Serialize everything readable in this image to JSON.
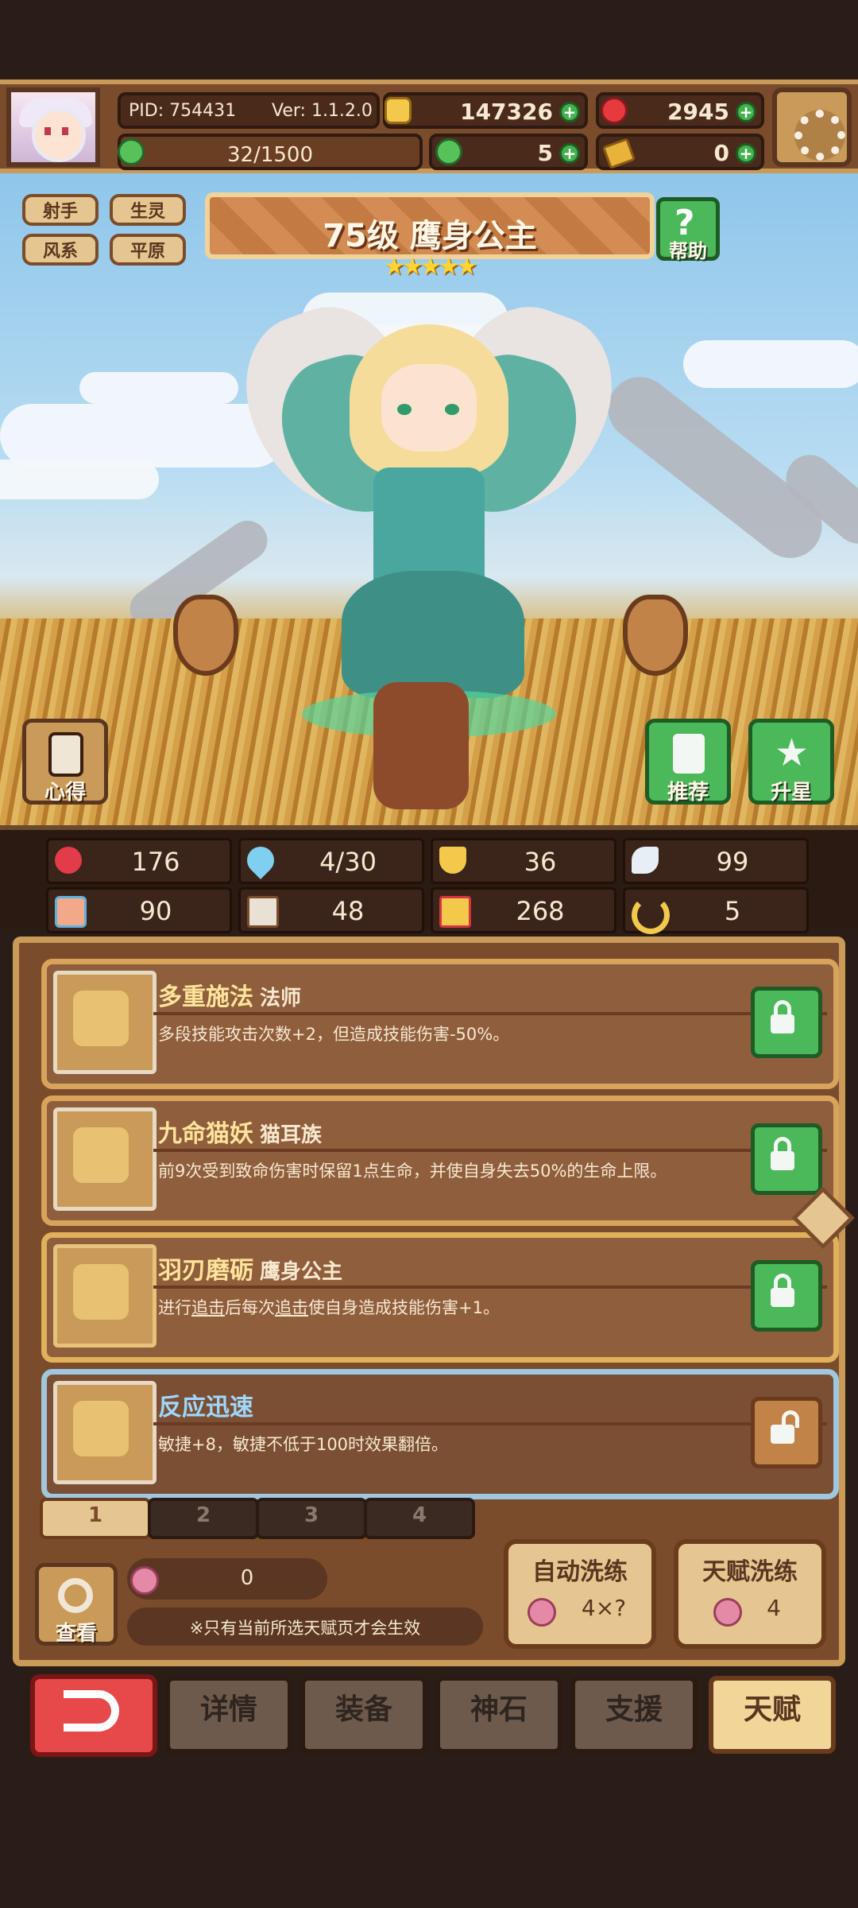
{
  "header": {
    "pid": "PID: 754431",
    "version": "Ver: 1.1.2.0",
    "gold": "147326",
    "gems": "2945",
    "energy": "32/1500",
    "clover": "5",
    "tickets": "0"
  },
  "hero": {
    "tags": [
      "射手",
      "生灵",
      "风系",
      "平原"
    ],
    "title": "75级 鹰身公主",
    "stars": 5,
    "star_glyphs": "★★★★★",
    "help_label": "帮助",
    "insight_label": "心得",
    "recommend_label": "推荐",
    "upstar_label": "升星"
  },
  "stats": [
    {
      "icon": "heart-icon",
      "value": "176"
    },
    {
      "icon": "water-drop-icon",
      "value": "4/30"
    },
    {
      "icon": "shield-icon",
      "value": "36"
    },
    {
      "icon": "wing-icon",
      "value": "99"
    },
    {
      "icon": "fist-icon",
      "value": "90"
    },
    {
      "icon": "book-icon",
      "value": "48"
    },
    {
      "icon": "boot-icon",
      "value": "268"
    },
    {
      "icon": "horseshoe-icon",
      "value": "5"
    }
  ],
  "talents": [
    {
      "name": "多重施法",
      "sub": "法师",
      "desc": "多段技能攻击次数+2，但造成技能伤害-50%。",
      "icon": "staff-icon",
      "locked": true
    },
    {
      "name": "九命猫妖",
      "sub": "猫耳族",
      "desc": "前9次受到致命伤害时保留1点生命，并使自身失去50%的生命上限。",
      "icon": "cat-icon",
      "locked": true
    },
    {
      "name": "羽刃磨砺",
      "sub": "鹰身公主",
      "desc_a": "进行",
      "desc_b": "追击",
      "desc_c": "后每次",
      "desc_d": "追击",
      "desc_e": "使自身造成技能伤害+1。",
      "icon": "star-icon",
      "locked": true
    },
    {
      "name": "反应迅速",
      "sub": "",
      "desc": "敏捷+8，敏捷不低于100时效果翻倍。",
      "icon": "cross-icon",
      "locked": false
    }
  ],
  "pages": [
    "1",
    "2",
    "3",
    "4"
  ],
  "active_page": 1,
  "bottom_panel": {
    "view_label": "查看",
    "fruit_count": "0",
    "hint": "※只有当前所选天赋页才会生效",
    "auto_refine_label": "自动洗练",
    "auto_refine_cost": "4×?",
    "talent_refine_label": "天赋洗练",
    "talent_refine_cost": "4"
  },
  "nav": [
    "详情",
    "装备",
    "神石",
    "支援",
    "天赋"
  ],
  "active_nav": "天赋"
}
